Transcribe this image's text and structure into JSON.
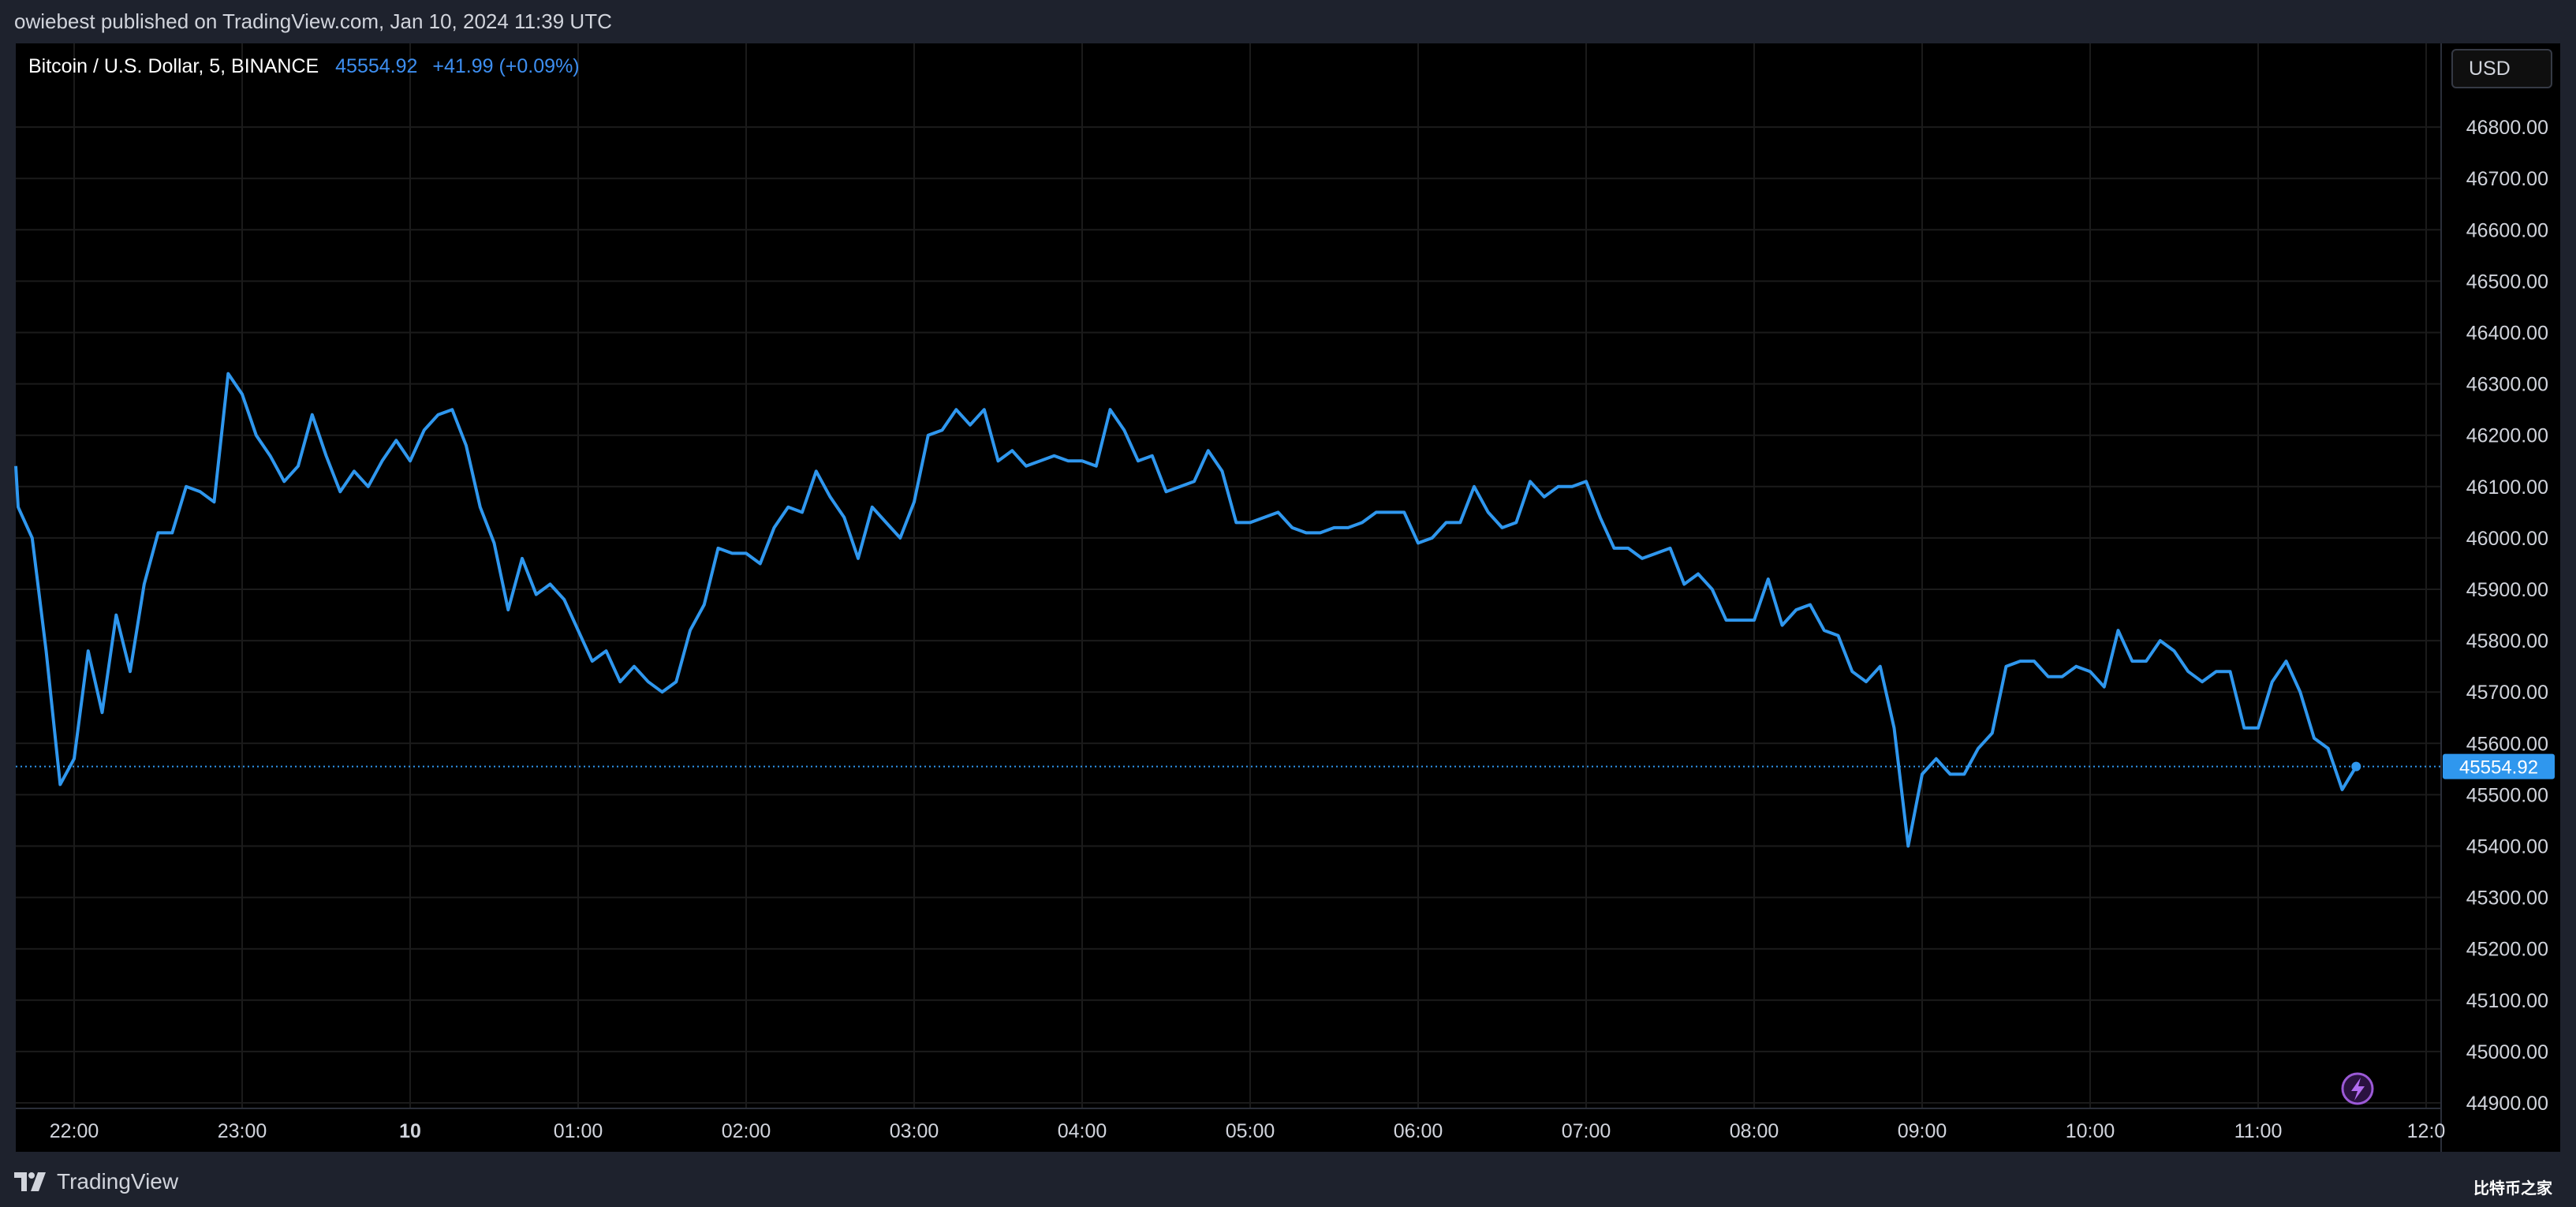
{
  "header": {
    "published_text": "owiebest published on TradingView.com, Jan 10, 2024 11:39 UTC"
  },
  "legend": {
    "symbol": "Bitcoin / U.S. Dollar, 5, BINANCE",
    "price": "45554.92",
    "change": "+41.99 (+0.09%)"
  },
  "currency_button": "USD",
  "brand": {
    "name": "TradingView"
  },
  "watermark": "比特币之家",
  "colors": {
    "background": "#000000",
    "frame": "#1e222d",
    "line": "#2f97ee",
    "grid": "#1b1b1b",
    "last_price_bg": "#2f97ee"
  },
  "chart_data": {
    "type": "line",
    "title": "Bitcoin / U.S. Dollar, 5, BINANCE",
    "xlabel": "",
    "ylabel": "",
    "ylim": [
      44890,
      46880
    ],
    "y_ticks": [
      "46800.00",
      "46700.00",
      "46600.00",
      "46500.00",
      "46400.00",
      "46300.00",
      "46200.00",
      "46100.00",
      "46000.00",
      "45900.00",
      "45800.00",
      "45700.00",
      "45600.00",
      "45500.00",
      "45400.00",
      "45300.00",
      "45200.00",
      "45100.00",
      "45000.00",
      "44900.00"
    ],
    "x_ticks": [
      {
        "label": "22:00",
        "t": 0,
        "bold": false
      },
      {
        "label": "23:00",
        "t": 60,
        "bold": false
      },
      {
        "label": "10",
        "t": 120,
        "bold": true
      },
      {
        "label": "01:00",
        "t": 180,
        "bold": false
      },
      {
        "label": "02:00",
        "t": 240,
        "bold": false
      },
      {
        "label": "03:00",
        "t": 300,
        "bold": false
      },
      {
        "label": "04:00",
        "t": 360,
        "bold": false
      },
      {
        "label": "05:00",
        "t": 420,
        "bold": false
      },
      {
        "label": "06:00",
        "t": 480,
        "bold": false
      },
      {
        "label": "07:00",
        "t": 540,
        "bold": false
      },
      {
        "label": "08:00",
        "t": 600,
        "bold": false
      },
      {
        "label": "09:00",
        "t": 660,
        "bold": false
      },
      {
        "label": "10:00",
        "t": 720,
        "bold": false
      },
      {
        "label": "11:00",
        "t": 780,
        "bold": false
      },
      {
        "label": "12:0",
        "t": 840,
        "bold": false
      }
    ],
    "last_price_label": "45554.92",
    "last_price": 45554.92,
    "series": [
      {
        "values": [
          [
            -21,
            46140
          ],
          [
            -20,
            46060
          ],
          [
            -15,
            46000
          ],
          [
            -10,
            45780
          ],
          [
            -5,
            45520
          ],
          [
            0,
            45570
          ],
          [
            5,
            45780
          ],
          [
            10,
            45660
          ],
          [
            15,
            45850
          ],
          [
            20,
            45740
          ],
          [
            25,
            45910
          ],
          [
            30,
            46010
          ],
          [
            35,
            46010
          ],
          [
            40,
            46100
          ],
          [
            45,
            46090
          ],
          [
            50,
            46070
          ],
          [
            55,
            46320
          ],
          [
            60,
            46280
          ],
          [
            65,
            46200
          ],
          [
            70,
            46160
          ],
          [
            75,
            46110
          ],
          [
            80,
            46140
          ],
          [
            85,
            46240
          ],
          [
            90,
            46160
          ],
          [
            95,
            46090
          ],
          [
            100,
            46130
          ],
          [
            105,
            46100
          ],
          [
            110,
            46150
          ],
          [
            115,
            46190
          ],
          [
            120,
            46150
          ],
          [
            125,
            46210
          ],
          [
            130,
            46240
          ],
          [
            135,
            46250
          ],
          [
            140,
            46180
          ],
          [
            145,
            46060
          ],
          [
            150,
            45990
          ],
          [
            155,
            45860
          ],
          [
            160,
            45960
          ],
          [
            165,
            45890
          ],
          [
            170,
            45910
          ],
          [
            175,
            45880
          ],
          [
            180,
            45820
          ],
          [
            185,
            45760
          ],
          [
            190,
            45780
          ],
          [
            195,
            45720
          ],
          [
            200,
            45750
          ],
          [
            205,
            45720
          ],
          [
            210,
            45700
          ],
          [
            215,
            45720
          ],
          [
            220,
            45820
          ],
          [
            225,
            45870
          ],
          [
            230,
            45980
          ],
          [
            235,
            45970
          ],
          [
            240,
            45970
          ],
          [
            245,
            45950
          ],
          [
            250,
            46020
          ],
          [
            255,
            46060
          ],
          [
            260,
            46050
          ],
          [
            265,
            46130
          ],
          [
            270,
            46080
          ],
          [
            275,
            46040
          ],
          [
            280,
            45960
          ],
          [
            285,
            46060
          ],
          [
            290,
            46030
          ],
          [
            295,
            46000
          ],
          [
            300,
            46070
          ],
          [
            305,
            46200
          ],
          [
            310,
            46210
          ],
          [
            315,
            46250
          ],
          [
            320,
            46220
          ],
          [
            325,
            46250
          ],
          [
            330,
            46150
          ],
          [
            335,
            46170
          ],
          [
            340,
            46140
          ],
          [
            345,
            46150
          ],
          [
            350,
            46160
          ],
          [
            355,
            46150
          ],
          [
            360,
            46150
          ],
          [
            365,
            46140
          ],
          [
            370,
            46250
          ],
          [
            375,
            46210
          ],
          [
            380,
            46150
          ],
          [
            385,
            46160
          ],
          [
            390,
            46090
          ],
          [
            395,
            46100
          ],
          [
            400,
            46110
          ],
          [
            405,
            46170
          ],
          [
            410,
            46130
          ],
          [
            415,
            46030
          ],
          [
            420,
            46030
          ],
          [
            425,
            46040
          ],
          [
            430,
            46050
          ],
          [
            435,
            46020
          ],
          [
            440,
            46010
          ],
          [
            445,
            46010
          ],
          [
            450,
            46020
          ],
          [
            455,
            46020
          ],
          [
            460,
            46030
          ],
          [
            465,
            46050
          ],
          [
            470,
            46050
          ],
          [
            475,
            46050
          ],
          [
            480,
            45990
          ],
          [
            485,
            46000
          ],
          [
            490,
            46030
          ],
          [
            495,
            46030
          ],
          [
            500,
            46100
          ],
          [
            505,
            46050
          ],
          [
            510,
            46020
          ],
          [
            515,
            46030
          ],
          [
            520,
            46110
          ],
          [
            525,
            46080
          ],
          [
            530,
            46100
          ],
          [
            535,
            46100
          ],
          [
            540,
            46110
          ],
          [
            545,
            46040
          ],
          [
            550,
            45980
          ],
          [
            555,
            45980
          ],
          [
            560,
            45960
          ],
          [
            565,
            45970
          ],
          [
            570,
            45980
          ],
          [
            575,
            45910
          ],
          [
            580,
            45930
          ],
          [
            585,
            45900
          ],
          [
            590,
            45840
          ],
          [
            595,
            45840
          ],
          [
            600,
            45840
          ],
          [
            605,
            45920
          ],
          [
            610,
            45830
          ],
          [
            615,
            45860
          ],
          [
            620,
            45870
          ],
          [
            625,
            45820
          ],
          [
            630,
            45810
          ],
          [
            635,
            45740
          ],
          [
            640,
            45720
          ],
          [
            645,
            45750
          ],
          [
            650,
            45630
          ],
          [
            655,
            45400
          ],
          [
            660,
            45540
          ],
          [
            665,
            45570
          ],
          [
            670,
            45540
          ],
          [
            675,
            45540
          ],
          [
            680,
            45590
          ],
          [
            685,
            45620
          ],
          [
            690,
            45750
          ],
          [
            695,
            45760
          ],
          [
            700,
            45760
          ],
          [
            705,
            45730
          ],
          [
            710,
            45730
          ],
          [
            715,
            45750
          ],
          [
            720,
            45740
          ],
          [
            725,
            45710
          ],
          [
            730,
            45820
          ],
          [
            735,
            45760
          ],
          [
            740,
            45760
          ],
          [
            745,
            45800
          ],
          [
            750,
            45780
          ],
          [
            755,
            45740
          ],
          [
            760,
            45720
          ],
          [
            765,
            45740
          ],
          [
            770,
            45740
          ],
          [
            775,
            45630
          ],
          [
            780,
            45630
          ],
          [
            785,
            45720
          ],
          [
            790,
            45760
          ],
          [
            795,
            45700
          ],
          [
            800,
            45610
          ],
          [
            805,
            45590
          ],
          [
            810,
            45510
          ],
          [
            815,
            45554.92
          ]
        ]
      }
    ]
  }
}
